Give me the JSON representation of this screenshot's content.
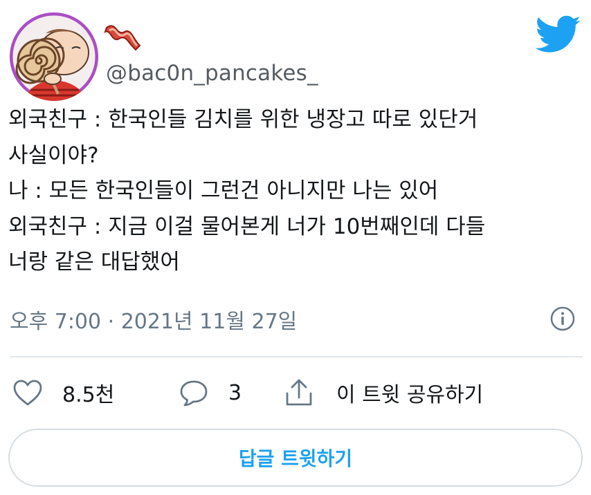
{
  "author": {
    "handle": "@bac0n_pancakes_",
    "avatar_icon": "character-eating-lollipop-avatar",
    "badge_icon": "bacon-emoji-icon"
  },
  "brand": {
    "logo_icon": "twitter-bird-icon",
    "color": "#1da1f2"
  },
  "tweet": {
    "lines": [
      "외국친구 : 한국인들 김치를 위한 냉장고 따로 있단거",
      "사실이야?",
      "나 : 모든 한국인들이 그런건 아니지만 나는 있어",
      "외국친구 : 지금 이걸 물어본게 너가 10번째인데 다들",
      "너랑 같은 대답했어"
    ],
    "timestamp": "오후 7:00 · 2021년 11월 27일",
    "info_icon": "info-circle-icon"
  },
  "actions": {
    "like": {
      "icon": "heart-icon",
      "count": "8.5천"
    },
    "reply": {
      "icon": "speech-bubble-icon",
      "count": "3"
    },
    "share": {
      "icon": "share-upload-icon",
      "label": "이 트윗 공유하기"
    }
  },
  "reply_button": {
    "label": "답글 트윗하기"
  }
}
